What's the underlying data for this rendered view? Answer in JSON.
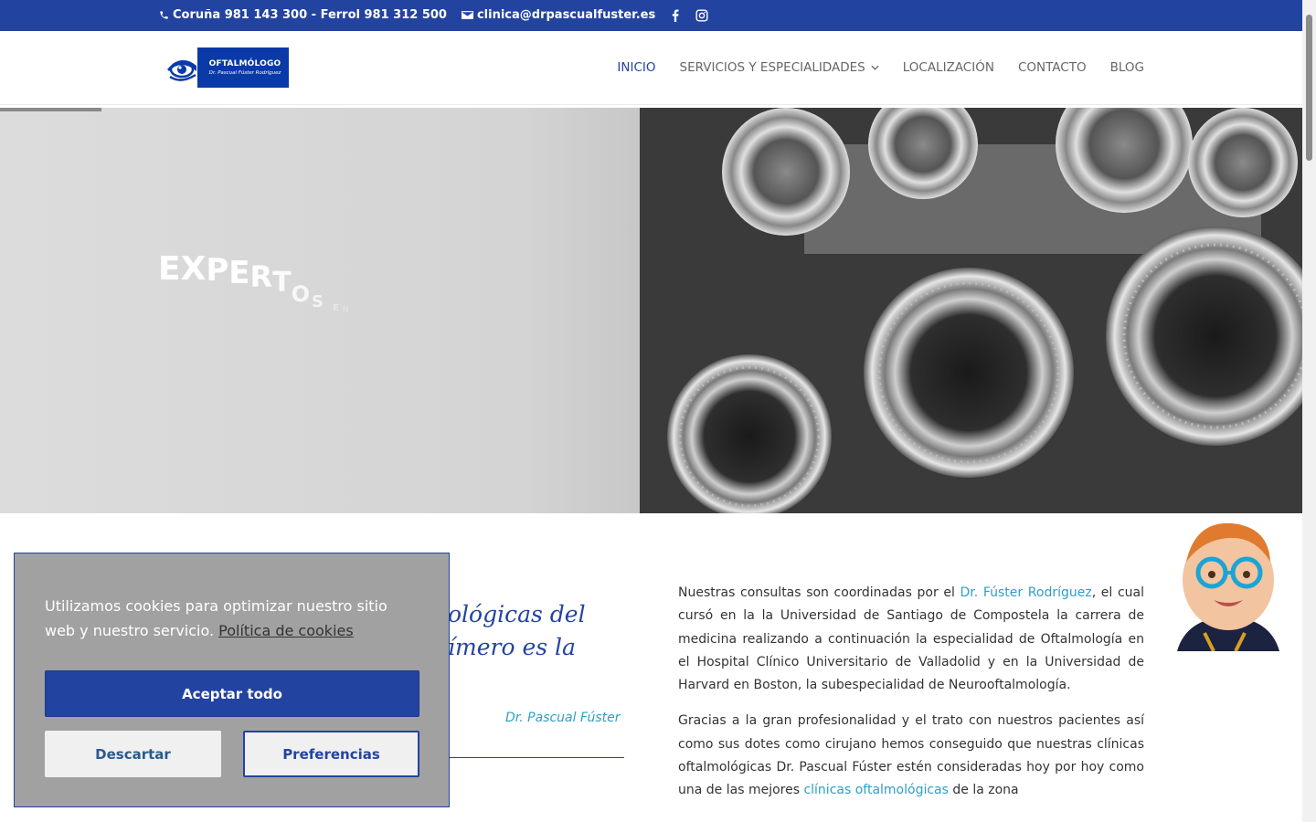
{
  "topbar": {
    "phone": "Coruña 981 143 300 - Ferrol 981 312 500",
    "email": "clinica@drpascualfuster.es",
    "icons": [
      "phone-icon",
      "mail-icon",
      "facebook-icon",
      "instagram-icon"
    ]
  },
  "logo": {
    "title": "OFTALMÓLOGO",
    "subtitle": "Dr. Pascual Fúster Rodríguez"
  },
  "nav": {
    "items": [
      "INICIO",
      "SERVICIOS Y ESPECIALIDADES",
      "LOCALIZACIÓN",
      "CONTACTO",
      "BLOG"
    ],
    "active": "INICIO"
  },
  "hero": {
    "letters": [
      "E",
      "X",
      "P",
      "E",
      "R",
      "T",
      "O",
      "S",
      "E",
      "N"
    ]
  },
  "quote": {
    "line1": "ológicas del",
    "line2": "ímero es la",
    "author": "Dr. Pascual Fúster"
  },
  "content": {
    "p1_before": "Nuestras consultas son coordinadas por el ",
    "p1_link": "Dr. Fúster Rodríguez",
    "p1_after": ", el cual cursó en la la Universidad de Santiago de Compostela la carrera de medicina realizando a continuación la especialidad de Oftalmología en el Hospital Clínico Universitario de Valladolid y en la Universidad de Harvard en Boston, la subespecialidad de Neurooftalmología.",
    "p2_before": "Gracias a la gran profesionalidad y el trato con nuestros pacientes así como sus dotes como cirujano hemos conseguido que nuestras clínicas oftalmológicas Dr. Pascual Fúster estén consideradas hoy por hoy como una de las mejores ",
    "p2_link": "clínicas oftalmológicas",
    "p2_after": " de la zona"
  },
  "cookie": {
    "message": "Utilizamos cookies para optimizar nuestro sitio web y nuestro servicio.",
    "policy_link": "Política de cookies",
    "accept": "Aceptar todo",
    "dismiss": "Descartar",
    "preferences": "Preferencias"
  },
  "colors": {
    "brand_blue": "#2343a0",
    "link": "#2e9fc7"
  }
}
